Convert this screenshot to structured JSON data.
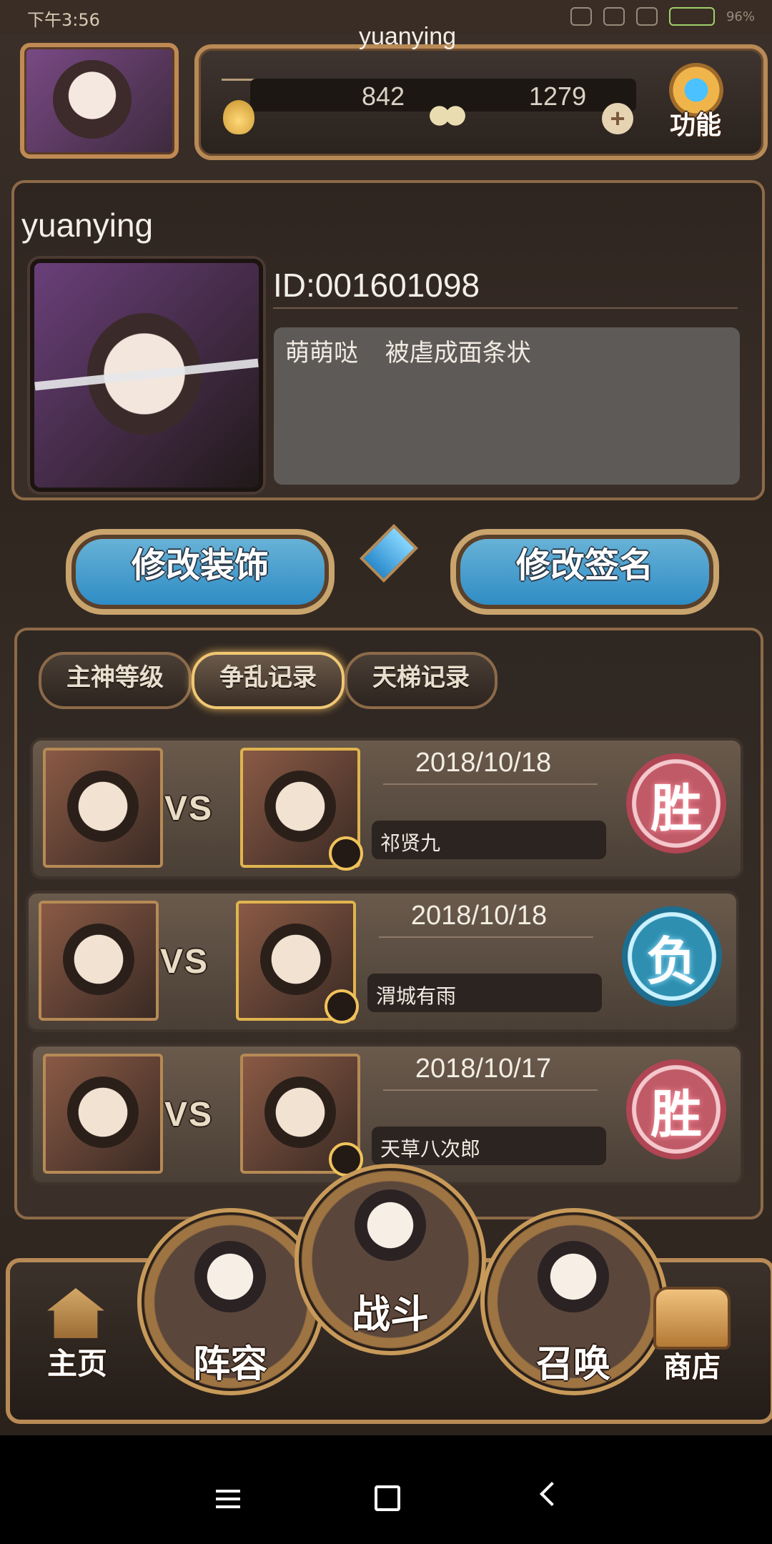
{
  "status_bar": {
    "time": "下午3:56",
    "battery_text": "96%"
  },
  "top_bar": {
    "player_name": "yuanying",
    "resource_1_value": "842",
    "resource_2_value": "1279",
    "function_label": "功能",
    "icons": [
      "flame-icon",
      "butterfly-icon",
      "plus-icon",
      "gear-icon"
    ]
  },
  "profile": {
    "name": "yuanying",
    "id_text": "ID:001601098",
    "signature": "萌萌哒    被虐成面条状"
  },
  "actions": {
    "edit_decoration": "修改装饰",
    "edit_signature": "修改签名"
  },
  "tabs": [
    {
      "label": "主神等级"
    },
    {
      "label": "争乱记录",
      "active": true
    },
    {
      "label": "天梯记录"
    }
  ],
  "records": [
    {
      "date": "2018/10/18",
      "opponent": "祁贤九",
      "result": "胜",
      "vs": "VS"
    },
    {
      "date": "2018/10/18",
      "opponent": "渭城有雨",
      "result": "负",
      "vs": "VS"
    },
    {
      "date": "2018/10/17",
      "opponent": "天草八次郎",
      "result": "胜",
      "vs": "VS"
    }
  ],
  "bottom_nav": {
    "home": "主页",
    "lineup": "阵容",
    "battle": "战斗",
    "summon": "召唤",
    "shop": "商店"
  },
  "colors": {
    "accent_gold": "#b88a56",
    "win_red": "#c05a67",
    "lose_blue": "#2f8fb1",
    "button_blue": "#2b8ac3"
  }
}
